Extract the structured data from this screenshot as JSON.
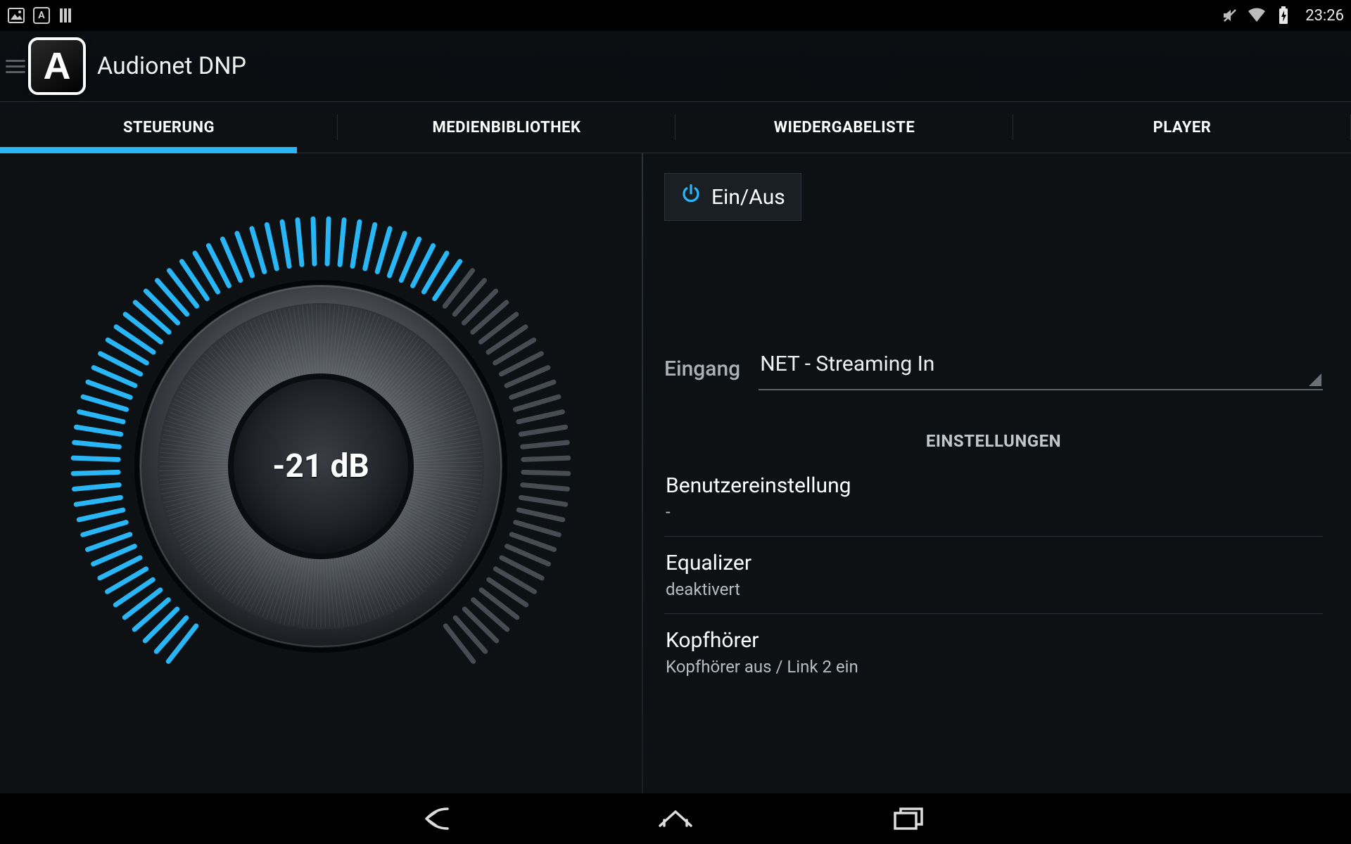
{
  "status": {
    "time": "23:26"
  },
  "app": {
    "title": "Audionet DNP",
    "icon_letter": "A"
  },
  "tabs": {
    "items": [
      {
        "label": "STEUERUNG"
      },
      {
        "label": "MEDIENBIBLIOTHEK"
      },
      {
        "label": "WIEDERGABELISTE"
      },
      {
        "label": "PLAYER"
      }
    ],
    "active_index": 0
  },
  "dial": {
    "value_label": "-21 dB",
    "tick_count": 80,
    "active_ticks": 50,
    "start_angle_deg": 128,
    "sweep_deg": 284
  },
  "controls": {
    "power_label": "Ein/Aus",
    "input_label": "Eingang",
    "input_value": "NET - Streaming In",
    "settings_header": "EINSTELLUNGEN",
    "settings": [
      {
        "title": "Benutzereinstellung",
        "subtitle": "-"
      },
      {
        "title": "Equalizer",
        "subtitle": "deaktivert"
      },
      {
        "title": "Kopfhörer",
        "subtitle": "Kopfhörer aus / Link 2 ein"
      }
    ]
  },
  "colors": {
    "accent": "#29b6f6",
    "tick_off": "#464c52"
  }
}
